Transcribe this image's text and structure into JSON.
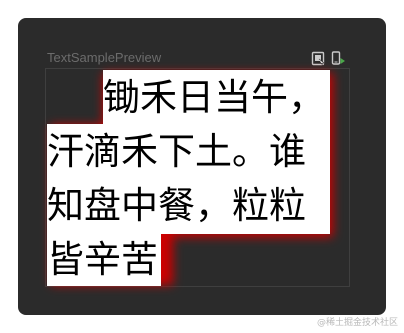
{
  "preview": {
    "title": "TextSamplePreview",
    "toolbar_icons": [
      "interactive-mode-icon",
      "deploy-preview-icon"
    ]
  },
  "poem": {
    "lines": [
      "锄禾日当午，",
      "汗滴禾下土。谁",
      "知盘中餐，粒粒",
      "皆辛苦"
    ]
  },
  "colors": {
    "panel_background": "#2b2b2b",
    "text_background": "#ffffff",
    "glow": "#cc0000",
    "text": "#000000"
  },
  "watermark": "@稀土掘金技术社区"
}
